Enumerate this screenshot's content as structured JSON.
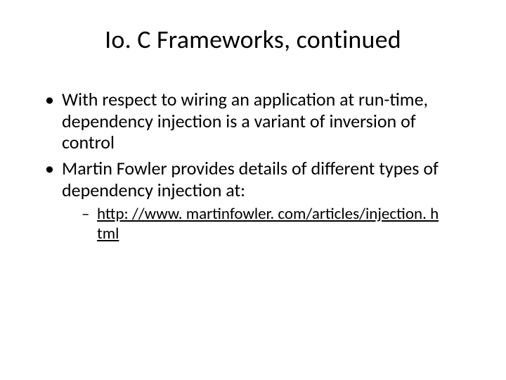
{
  "title": "Io. C Frameworks, continued",
  "bullets": [
    "With respect to wiring an application at run-time, dependency injection is a variant of inversion of control",
    "Martin Fowler provides details of different types of dependency injection at:"
  ],
  "sub_link_text": "http: //www. martinfowler. com/articles/injection. h tml"
}
